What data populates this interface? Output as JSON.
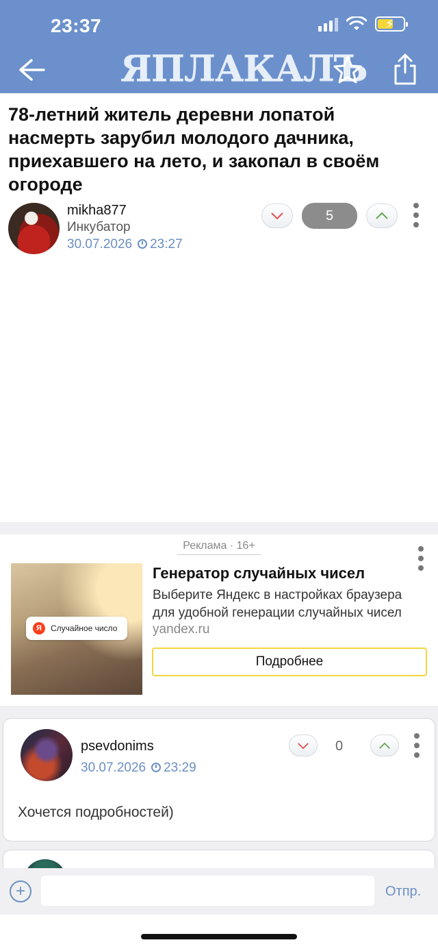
{
  "status_bar": {
    "time": "23:37"
  },
  "header": {
    "logo_text": "ЯПЛАКАЛЪ",
    "brand_color": "#6b90cc"
  },
  "post": {
    "title": "78-летний житель деревни лопатой насмерть зарубил молодого дачника, приехавшего на лето, и закопал в своём огороде",
    "author": "mikha877",
    "rank": "Инкубатор",
    "date": "30.07.2026",
    "time": "23:27",
    "rating": "5"
  },
  "ad": {
    "label": "Реклама · 16+",
    "chip_text": "Случайное число",
    "title": "Генератор случайных чисел",
    "description": "Выберите Яндекс в настройках браузера для удобной генерации случайных чисел",
    "domain": "yandex.ru",
    "button_label": "Подробнее"
  },
  "comments": [
    {
      "author": "psevdonims",
      "date": "30.07.2026",
      "time": "23:29",
      "rating": "0",
      "text": "Хочется подробностей)"
    }
  ],
  "input_bar": {
    "placeholder": "",
    "send_label": "Отпр."
  }
}
